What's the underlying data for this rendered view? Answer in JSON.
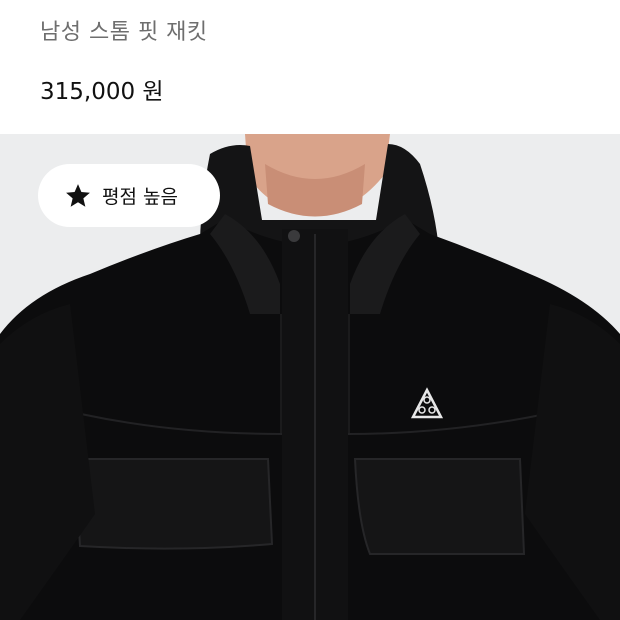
{
  "product": {
    "name": "남성 스톰 핏 재킷",
    "price": "315,000 원"
  },
  "badge": {
    "label": "평점 높음",
    "icon": "star-icon"
  },
  "image": {
    "logo_text": "ACG",
    "colors": {
      "background": "#ecedee",
      "jacket": "#0c0c0d",
      "skin": "#d9a38a"
    }
  }
}
